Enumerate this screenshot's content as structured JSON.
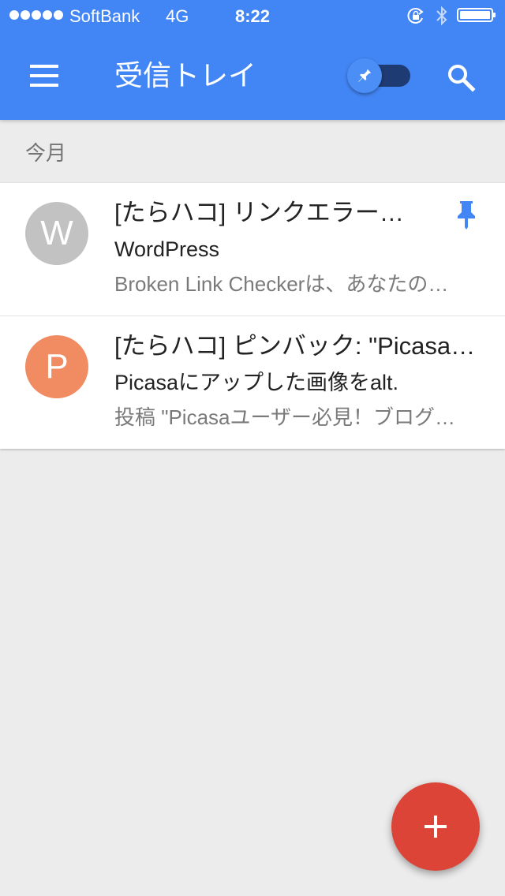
{
  "status_bar": {
    "signal_icon": "signal-dots-icon",
    "carrier": "SoftBank",
    "network": "4G",
    "time": "8:22",
    "orientation_lock_icon": "rotation-lock-icon",
    "bluetooth_icon": "bluetooth-icon",
    "battery_icon": "battery-icon"
  },
  "app_bar": {
    "menu_icon": "hamburger-menu-icon",
    "title": "受信トレイ",
    "pin_toggle_icon": "pin-icon",
    "pin_toggle_on": true,
    "search_icon": "search-icon",
    "background_color": "#4285f4"
  },
  "section": {
    "label": "今月"
  },
  "mails": [
    {
      "avatar_letter": "W",
      "avatar_color": "#c2c2c2",
      "subject": "[たらハコ] リンクエラー…",
      "sender": "WordPress",
      "snippet": "Broken Link Checkerは、あなたの…",
      "pinned": true
    },
    {
      "avatar_letter": "P",
      "avatar_color": "#f08b62",
      "subject": "[たらハコ] ピンバック: \"Picasa…",
      "sender": "Picasaにアップした画像をalt.",
      "snippet": "投稿 \"Picasaユーザー必見！ブログ…",
      "pinned": false
    }
  ],
  "fab": {
    "icon": "plus-icon",
    "color": "#db4437"
  }
}
